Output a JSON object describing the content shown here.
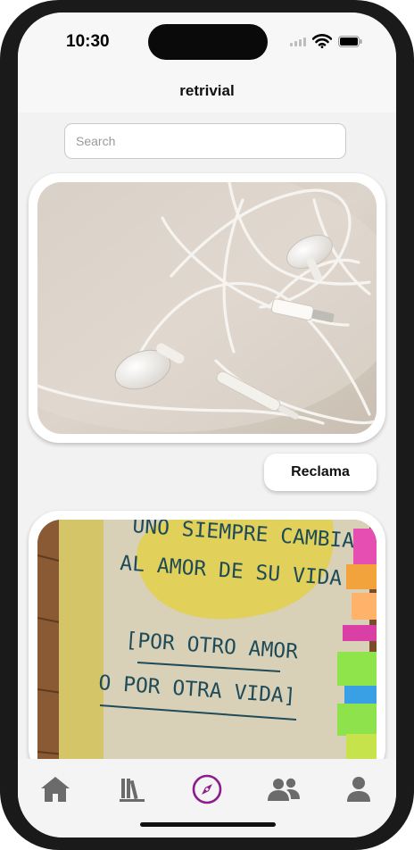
{
  "status_bar": {
    "time": "10:30",
    "icons": [
      "signal-icon",
      "wifi-icon",
      "battery-icon"
    ]
  },
  "header": {
    "title": "retrivial"
  },
  "search": {
    "placeholder": "Search",
    "value": ""
  },
  "feed": {
    "items": [
      {
        "image": "white wired earphones tangled on a plate",
        "button_label": "Reclama"
      },
      {
        "image": "yellow book cover with handwritten text",
        "book_cover_text": [
          "UNO SIEMPRE CAMBIA",
          "AL AMOR DE SU VIDA",
          "[POR OTRO AMOR",
          "O POR OTRA VIDA]"
        ]
      }
    ]
  },
  "tab_bar": {
    "tabs": [
      {
        "icon": "home-icon",
        "active": false
      },
      {
        "icon": "library-icon",
        "active": false
      },
      {
        "icon": "compass-icon",
        "active": true
      },
      {
        "icon": "users-icon",
        "active": false
      },
      {
        "icon": "profile-icon",
        "active": false
      }
    ],
    "active_color": "#8b1c8b",
    "inactive_color": "#6b6b6b"
  }
}
